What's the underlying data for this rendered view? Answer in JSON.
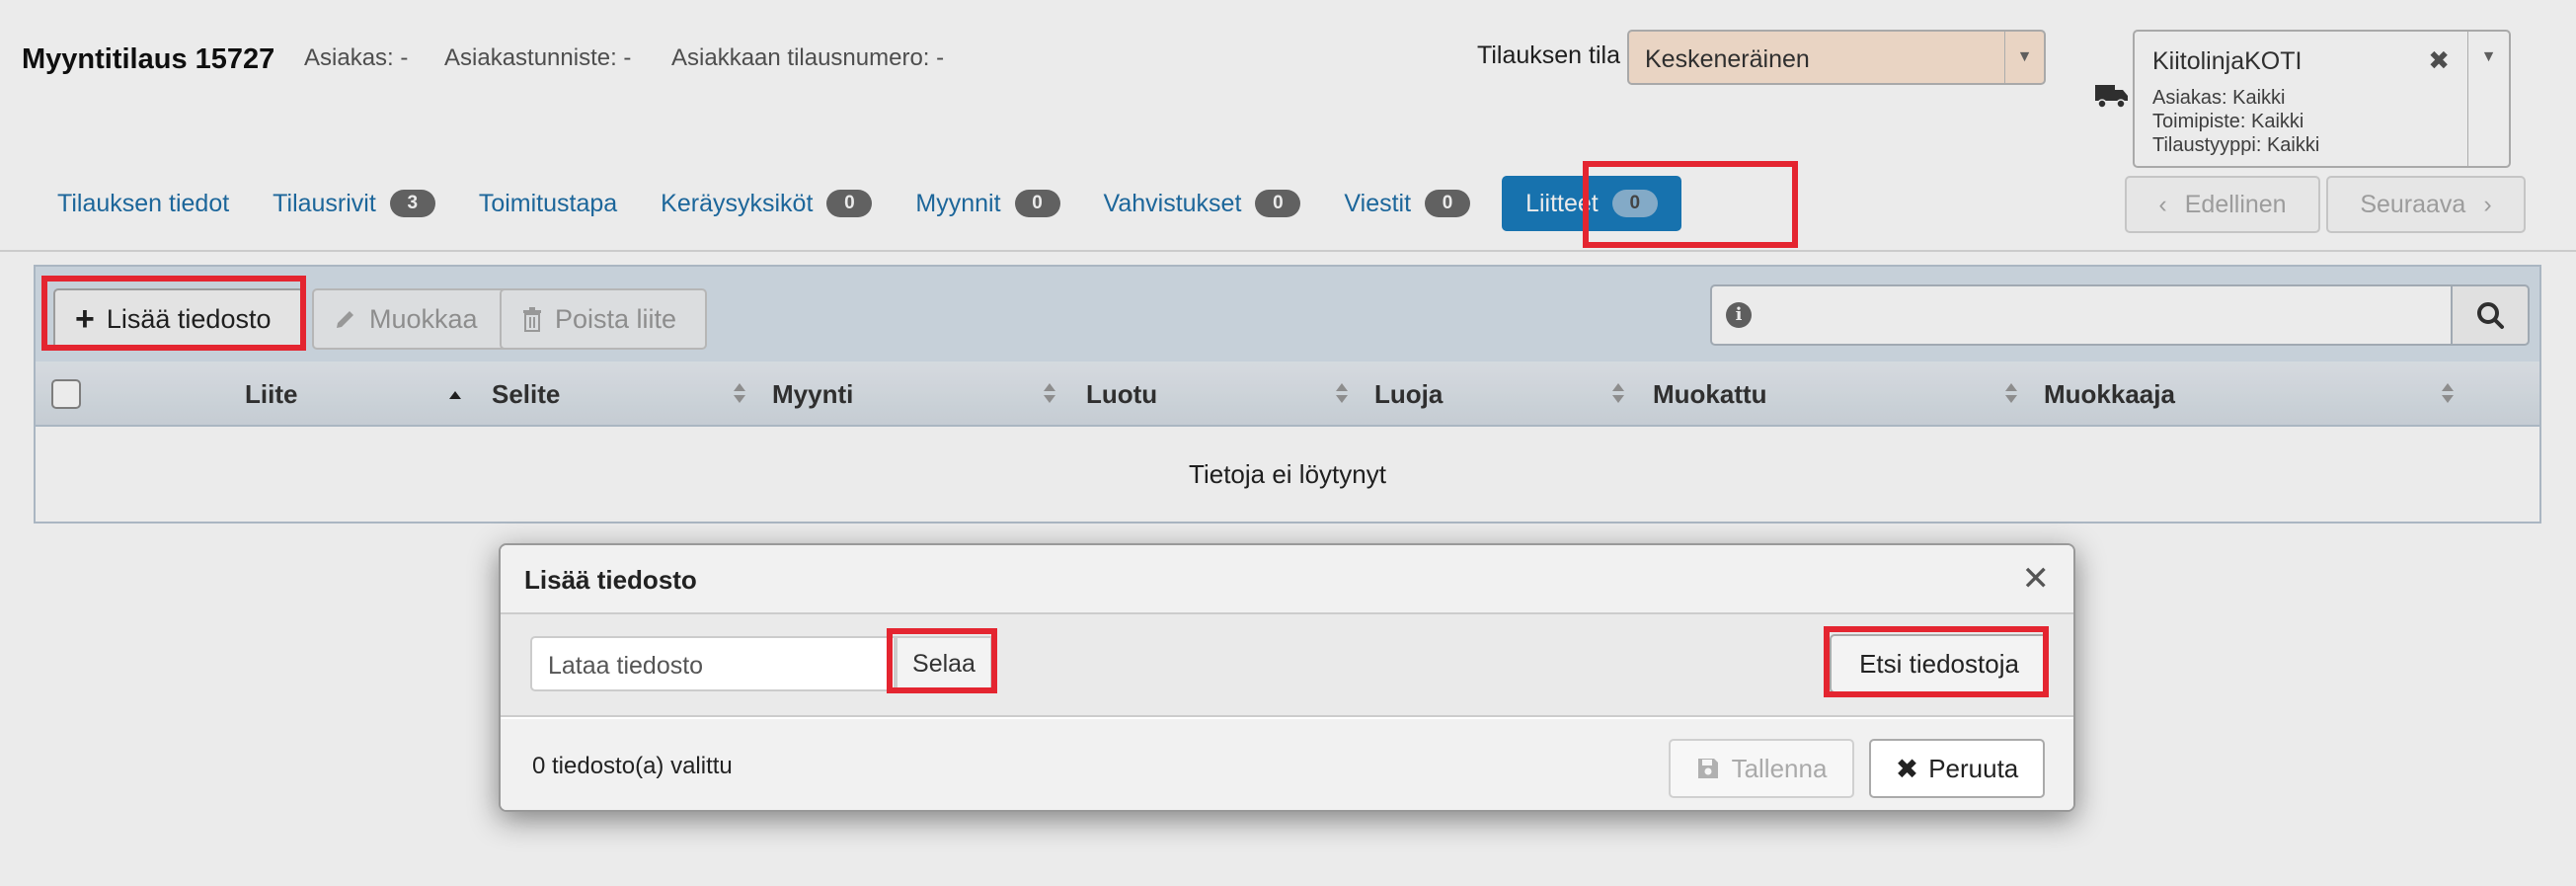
{
  "header": {
    "title": "Myyntitilaus 15727",
    "customer": "Asiakas: -",
    "customer_id": "Asiakastunniste: -",
    "customer_order_no": "Asiakkaan tilausnumero: -",
    "order_state_label": "Tilauksen tila",
    "order_state_value": "Keskeneräinen"
  },
  "filter_box": {
    "title": "KiitolinjaKOTI",
    "line1": "Asiakas:  Kaikki",
    "line2": "Toimipiste:  Kaikki",
    "line3": "Tilaustyyppi:  Kaikki"
  },
  "tabs": [
    {
      "label": "Tilauksen tiedot",
      "badge": ""
    },
    {
      "label": "Tilausrivit",
      "badge": "3"
    },
    {
      "label": "Toimitustapa",
      "badge": ""
    },
    {
      "label": "Keräysyksiköt",
      "badge": "0"
    },
    {
      "label": "Myynnit",
      "badge": "0"
    },
    {
      "label": "Vahvistukset",
      "badge": "0"
    },
    {
      "label": "Viestit",
      "badge": "0"
    },
    {
      "label": "Liitteet",
      "badge": "0",
      "active": true
    }
  ],
  "nav": {
    "prev": "Edellinen",
    "next": "Seuraava"
  },
  "toolbar": {
    "add": "Lisää tiedosto",
    "edit": "Muokkaa",
    "delete": "Poista liite"
  },
  "table": {
    "columns": [
      "Liite",
      "Selite",
      "Myynti",
      "Luotu",
      "Luoja",
      "Muokattu",
      "Muokkaaja"
    ],
    "empty": "Tietoja ei löytynyt"
  },
  "modal": {
    "title": "Lisää tiedosto",
    "upload_placeholder": "Lataa tiedosto",
    "browse": "Selaa",
    "search_files": "Etsi tiedostoja",
    "selected_count": "0 tiedosto(a) valittu",
    "save": "Tallenna",
    "cancel": "Peruuta"
  },
  "colors": {
    "accent": "#1a7cbd",
    "highlight": "#e42530",
    "state_bg": "#fde6d4"
  }
}
